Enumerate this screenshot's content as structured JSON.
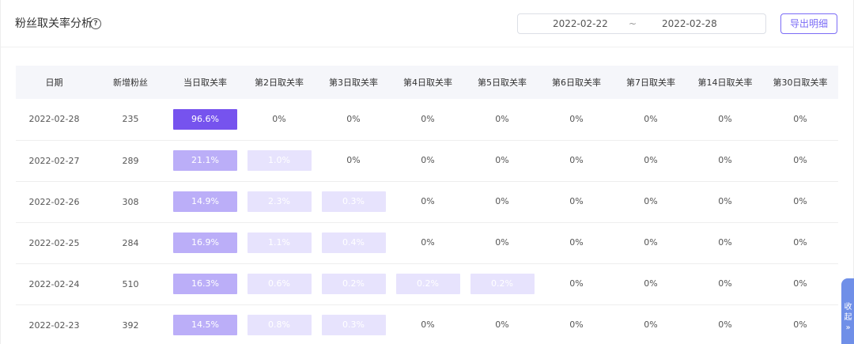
{
  "header": {
    "title": "粉丝取关率分析",
    "help_glyph": "?",
    "date_start": "2022-02-22",
    "date_separator": "~",
    "date_end": "2022-02-28",
    "export_label": "导出明细"
  },
  "table": {
    "columns": [
      "日期",
      "新增粉丝",
      "当日取关率",
      "第2日取关率",
      "第3日取关率",
      "第4日取关率",
      "第5日取关率",
      "第6日取关率",
      "第7日取关率",
      "第14日取关率",
      "第30日取关率"
    ],
    "rows": [
      {
        "date": "2022-02-28",
        "new_fans": "235",
        "rates": [
          "96.6%",
          "0%",
          "0%",
          "0%",
          "0%",
          "0%",
          "0%",
          "0%",
          "0%"
        ],
        "highlighted": 1
      },
      {
        "date": "2022-02-27",
        "new_fans": "289",
        "rates": [
          "21.1%",
          "1.0%",
          "0%",
          "0%",
          "0%",
          "0%",
          "0%",
          "0%",
          "0%"
        ],
        "highlighted": 2
      },
      {
        "date": "2022-02-26",
        "new_fans": "308",
        "rates": [
          "14.9%",
          "2.3%",
          "0.3%",
          "0%",
          "0%",
          "0%",
          "0%",
          "0%",
          "0%"
        ],
        "highlighted": 3
      },
      {
        "date": "2022-02-25",
        "new_fans": "284",
        "rates": [
          "16.9%",
          "1.1%",
          "0.4%",
          "0%",
          "0%",
          "0%",
          "0%",
          "0%",
          "0%"
        ],
        "highlighted": 3
      },
      {
        "date": "2022-02-24",
        "new_fans": "510",
        "rates": [
          "16.3%",
          "0.6%",
          "0.2%",
          "0.2%",
          "0.2%",
          "0%",
          "0%",
          "0%",
          "0%"
        ],
        "highlighted": 5
      },
      {
        "date": "2022-02-23",
        "new_fans": "392",
        "rates": [
          "14.5%",
          "0.8%",
          "0.3%",
          "0%",
          "0%",
          "0%",
          "0%",
          "0%",
          "0%"
        ],
        "highlighted": 3
      }
    ]
  },
  "colors": {
    "accent": "#7b6cf6",
    "strong": "#7653ee",
    "medium": "#bbaef8",
    "light": "#e7e3fd"
  },
  "collapse_tab": {
    "label": "收起",
    "arrow": "»"
  }
}
